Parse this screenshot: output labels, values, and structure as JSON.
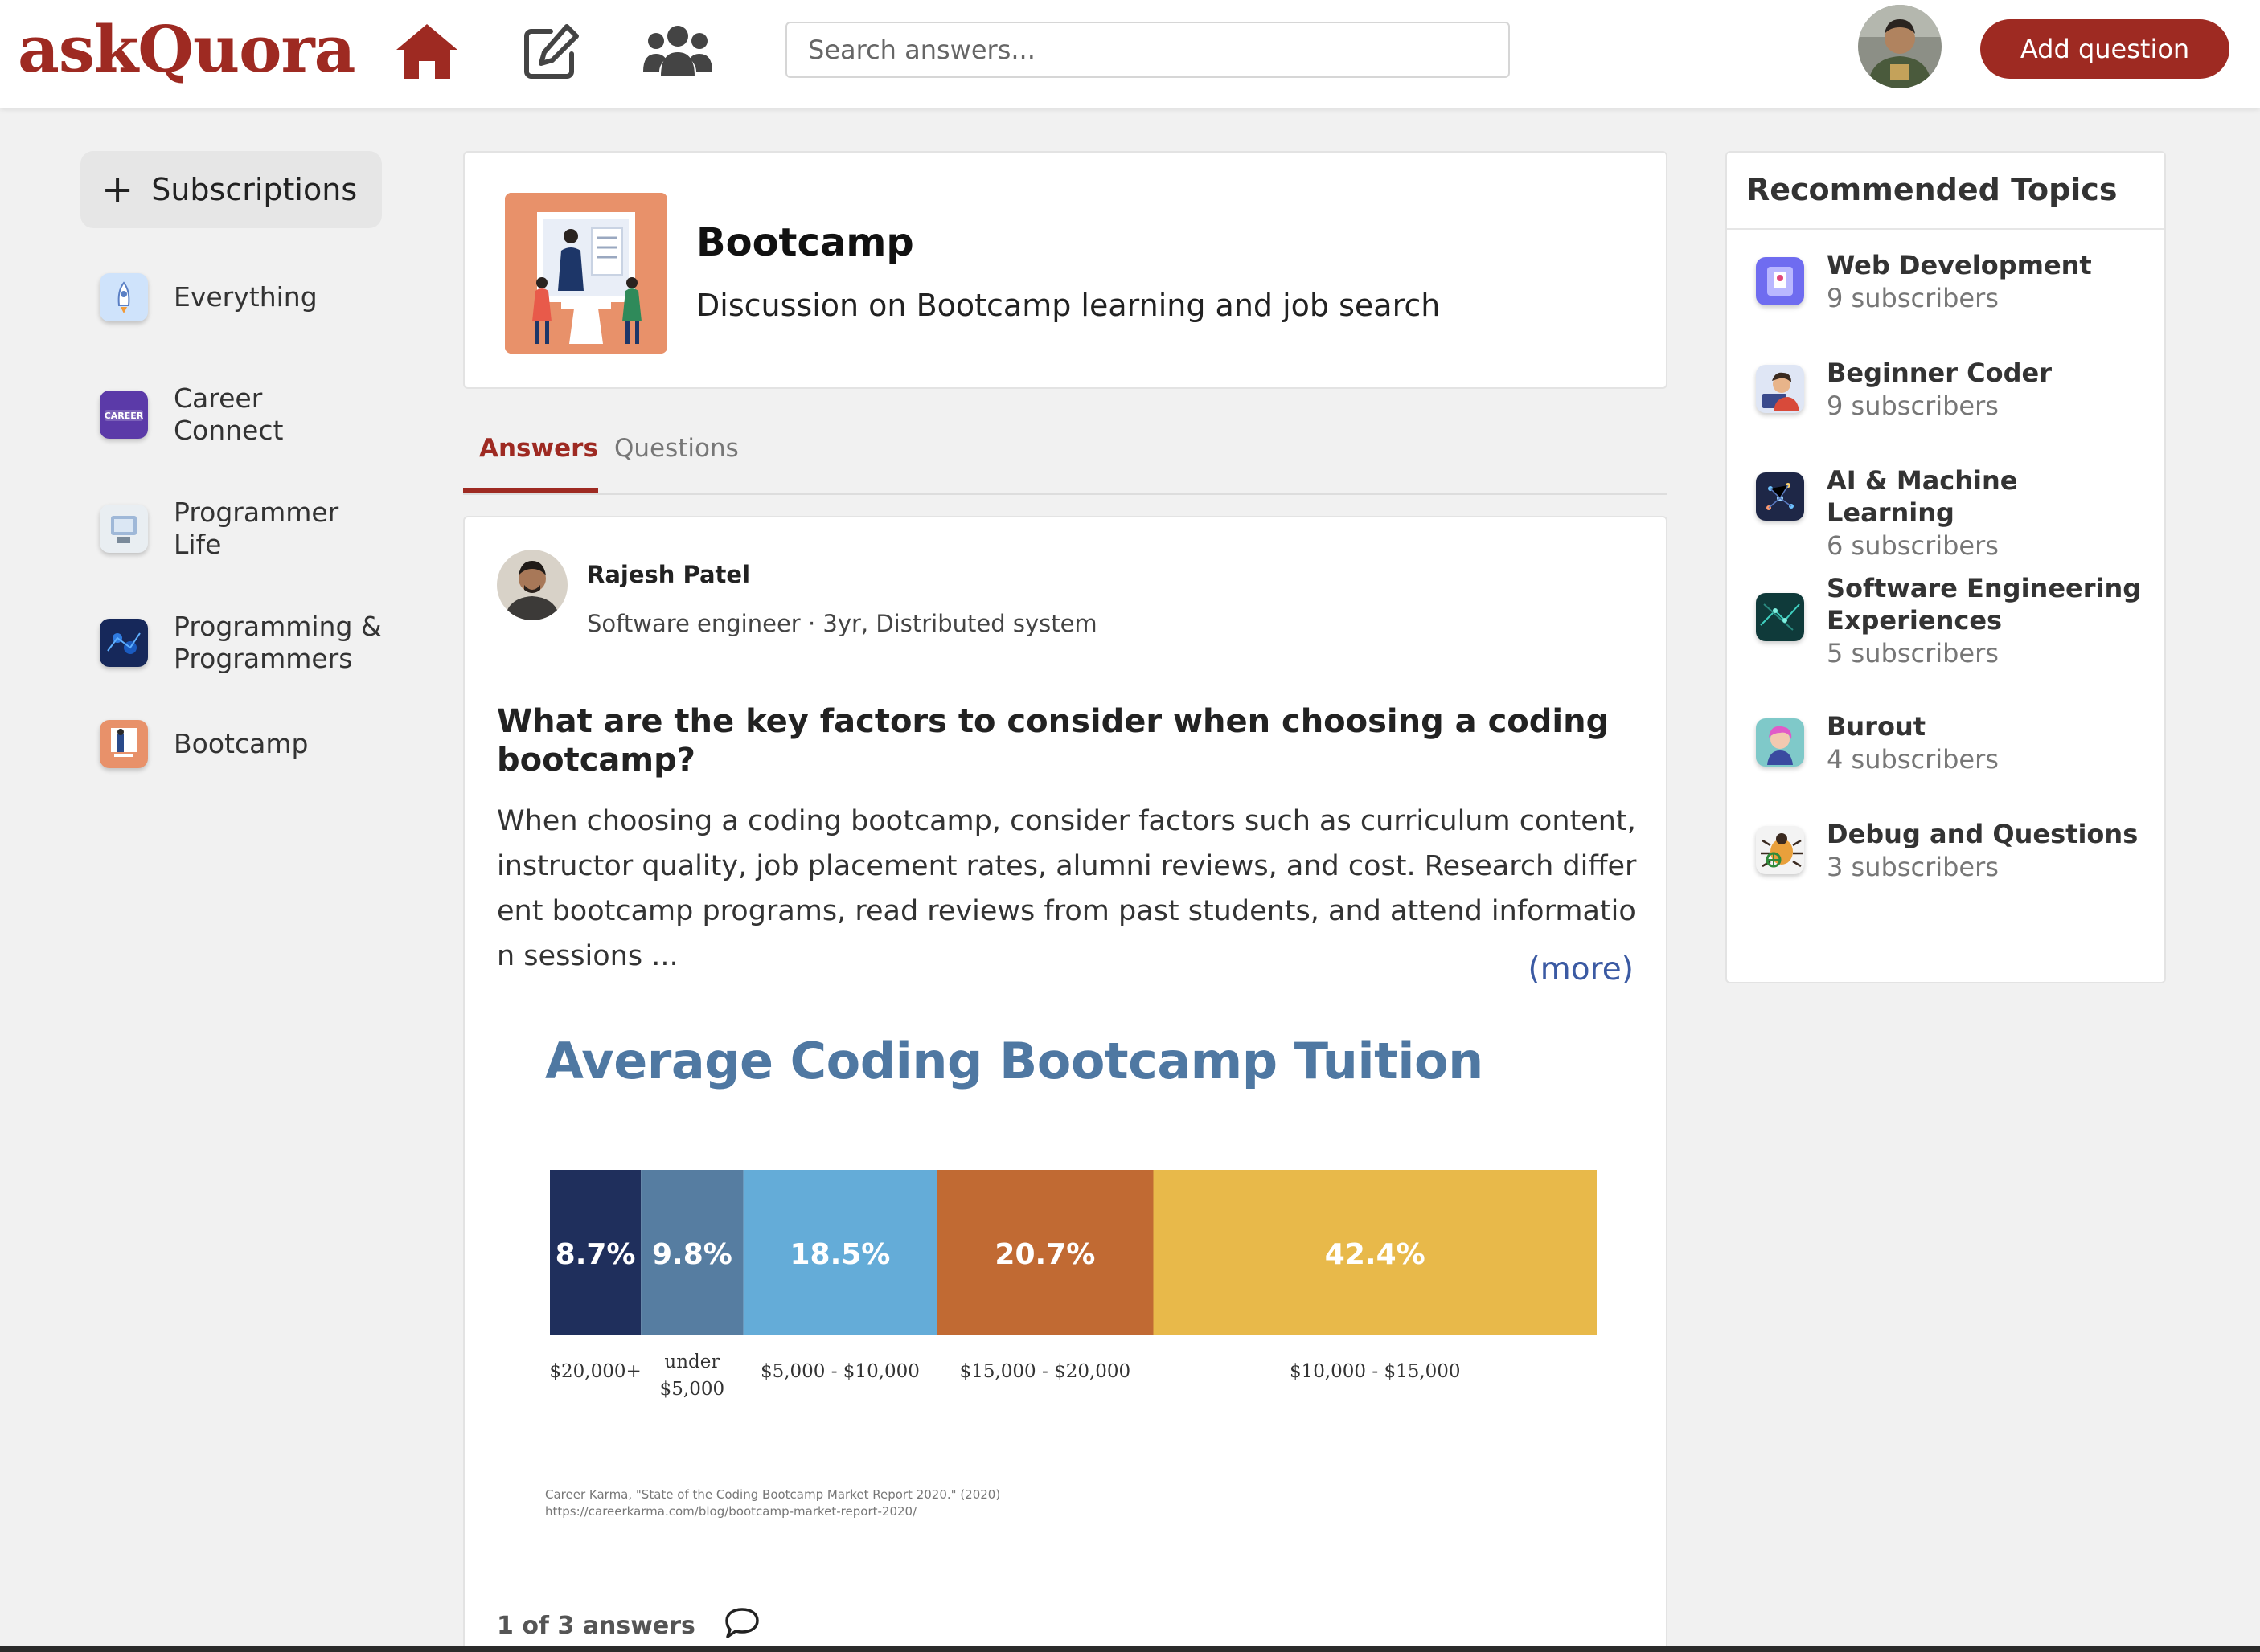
{
  "header": {
    "logo": "askQuora",
    "search_placeholder": "Search answers...",
    "add_question_label": "Add question"
  },
  "sidebar": {
    "subscriptions_label": "Subscriptions",
    "items": [
      {
        "label": "Everything",
        "icon": "rocket-icon",
        "color": "#cfe3fb"
      },
      {
        "label": "Career Connect",
        "icon": "career-icon",
        "color": "#5b3aa8"
      },
      {
        "label": "Programmer Life",
        "icon": "programmer-icon",
        "color": "#e9eef2"
      },
      {
        "label": "Programming & Programmers",
        "icon": "circuit-icon",
        "color": "#16285a"
      },
      {
        "label": "Bootcamp",
        "icon": "bootcamp-icon",
        "color": "#e8916a"
      }
    ]
  },
  "topic": {
    "name": "Bootcamp",
    "description": "Discussion on Bootcamp learning and job search"
  },
  "tabs": {
    "answers": "Answers",
    "questions": "Questions"
  },
  "answer": {
    "author_name": "Rajesh Patel",
    "author_credential": "Software engineer · 3yr, Distributed system",
    "question": "What are the key factors to consider when choosing a coding bootcamp?",
    "body": "When choosing a coding bootcamp, consider factors such as curriculum content, instructor quality, job placement rates, alumni reviews, and cost. Research different bootcamp programs, read reviews from past students, and attend information sessions ...",
    "more_label": "(more)",
    "count_label": "1 of 3 answers"
  },
  "chart_data": {
    "type": "bar",
    "subtype": "stacked-100",
    "title": "Average Coding Bootcamp Tuition",
    "categories": [
      "$20,000+",
      "under $5,000",
      "$5,000 - $10,000",
      "$15,000 - $20,000",
      "$10,000 - $15,000"
    ],
    "values": [
      8.7,
      9.8,
      18.5,
      20.7,
      42.4
    ],
    "value_labels": [
      "8.7%",
      "9.8%",
      "18.5%",
      "20.7%",
      "42.4%"
    ],
    "colors": [
      "#1f2f5c",
      "#567da1",
      "#64acd8",
      "#c16a33",
      "#e8b94a"
    ],
    "source": [
      "Career Karma, \"State of the Coding Bootcamp Market Report 2020.\" (2020)",
      "https://careerkarma.com/blog/bootcamp-market-report-2020/"
    ]
  },
  "recommended": {
    "title": "Recommended Topics",
    "items": [
      {
        "name": "Web Development",
        "subs": "9 subscribers",
        "icon": "web-dev-icon",
        "color": "#6f6cf0"
      },
      {
        "name": "Beginner Coder",
        "subs": "9 subscribers",
        "icon": "coder-icon",
        "color": "#3a4a8c"
      },
      {
        "name": "AI & Machine Learning",
        "subs": "6 subscribers",
        "icon": "ai-icon",
        "color": "#1e2747"
      },
      {
        "name": "Software Engineering Experiences",
        "subs": "5 subscribers",
        "icon": "software-icon",
        "color": "#0f3a3a"
      },
      {
        "name": "Burout",
        "subs": "4 subscribers",
        "icon": "burnout-icon",
        "color": "#7fc9c9"
      },
      {
        "name": "Debug and Questions",
        "subs": "3 subscribers",
        "icon": "bug-icon",
        "color": "#e9a03b"
      }
    ]
  },
  "colors": {
    "brand": "#9e2a22",
    "link": "#3b5aa3",
    "background": "#f1f1f1"
  }
}
